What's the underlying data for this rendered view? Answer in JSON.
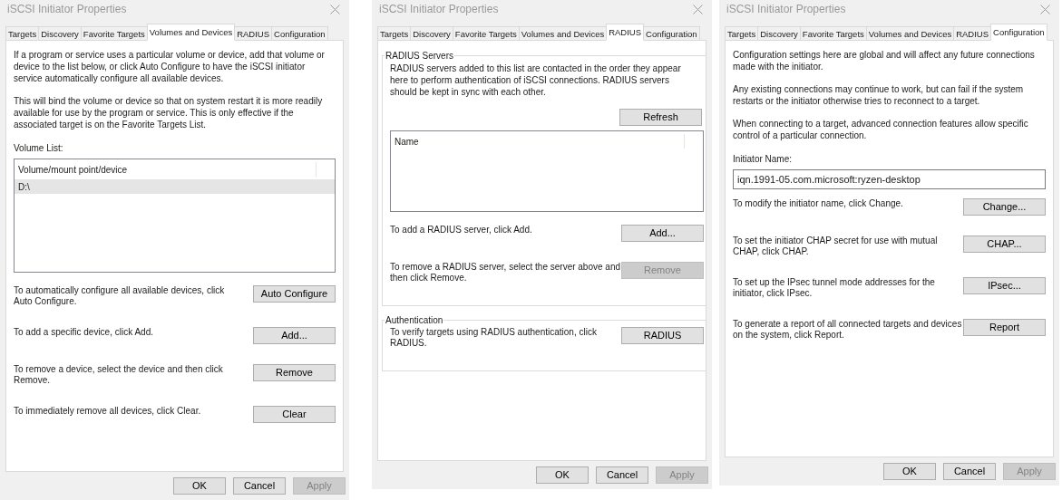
{
  "windows": [
    {
      "title": "iSCSI Initiator Properties",
      "tabs": [
        {
          "label": "Targets",
          "selected": false
        },
        {
          "label": "Discovery",
          "selected": false
        },
        {
          "label": "Favorite Targets",
          "selected": false
        },
        {
          "label": "Volumes and Devices",
          "selected": true
        },
        {
          "label": "RADIUS",
          "selected": false
        },
        {
          "label": "Configuration",
          "selected": false
        }
      ],
      "content": [
        {
          "kind": "paragraph",
          "text": "If a program or service uses a particular volume or device, add that volume or device to the list below, or click Auto Configure to have the iSCSI initiator service automatically configure all available devices."
        },
        {
          "kind": "paragraph",
          "text": "This will bind the volume or device so that on system restart it is more readily available for use by the program or service.  This is only effective if the associated target is on the Favorite Targets List."
        },
        {
          "kind": "label",
          "text": "Volume List:"
        },
        {
          "kind": "list",
          "header": "Volume/mount point/device",
          "rows": [
            {
              "text": "D:\\",
              "selected": true
            }
          ]
        },
        {
          "kind": "action",
          "text": "To automatically configure all available devices, click Auto Configure.",
          "button": "Auto Configure",
          "disabled": false
        },
        {
          "kind": "action",
          "text": "To add a specific device, click Add.",
          "button": "Add...",
          "disabled": false
        },
        {
          "kind": "action",
          "text": "To remove a device, select the device and then click Remove.",
          "button": "Remove",
          "disabled": false
        },
        {
          "kind": "action",
          "text": "To immediately remove all devices, click Clear.",
          "button": "Clear",
          "disabled": false
        }
      ],
      "buttons": [
        {
          "label": "OK",
          "disabled": false
        },
        {
          "label": "Cancel",
          "disabled": false
        },
        {
          "label": "Apply",
          "disabled": true
        }
      ]
    },
    {
      "title": "iSCSI Initiator Properties",
      "tabs": [
        {
          "label": "Targets",
          "selected": false
        },
        {
          "label": "Discovery",
          "selected": false
        },
        {
          "label": "Favorite Targets",
          "selected": false
        },
        {
          "label": "Volumes and Devices",
          "selected": false
        },
        {
          "label": "RADIUS",
          "selected": true
        },
        {
          "label": "Configuration",
          "selected": false
        }
      ],
      "content": [
        {
          "kind": "group",
          "title": "RADIUS Servers",
          "children": [
            {
              "kind": "paragraph",
              "text": "RADIUS servers added to this list are contacted in the order they appear here to perform authentication of iSCSI connections. RADIUS servers should be kept in sync with each other."
            },
            {
              "kind": "button",
              "button": "Refresh",
              "disabled": false
            },
            {
              "kind": "list",
              "header": "Name"
            },
            {
              "kind": "action",
              "text": "To add a RADIUS server, click Add.",
              "button": "Add...",
              "disabled": false
            },
            {
              "kind": "action",
              "text": "To remove a RADIUS server, select the server above and then click Remove.",
              "button": "Remove",
              "disabled": true
            }
          ]
        },
        {
          "kind": "group",
          "title": "Authentication",
          "children": [
            {
              "kind": "action",
              "text": "To verify targets using RADIUS authentication, click RADIUS.",
              "button": "RADIUS",
              "disabled": false
            }
          ]
        }
      ],
      "buttons": [
        {
          "label": "OK",
          "disabled": false
        },
        {
          "label": "Cancel",
          "disabled": false
        },
        {
          "label": "Apply",
          "disabled": true
        }
      ]
    },
    {
      "title": "iSCSI Initiator Properties",
      "tabs": [
        {
          "label": "Targets",
          "selected": false
        },
        {
          "label": "Discovery",
          "selected": false
        },
        {
          "label": "Favorite Targets",
          "selected": false
        },
        {
          "label": "Volumes and Devices",
          "selected": false
        },
        {
          "label": "RADIUS",
          "selected": false
        },
        {
          "label": "Configuration",
          "selected": true
        }
      ],
      "content": [
        {
          "kind": "paragraph",
          "text": "Configuration settings here are global and will affect any future connections made with the initiator."
        },
        {
          "kind": "paragraph",
          "text": "Any existing connections may continue to work, but can fail if the system restarts or the initiator otherwise tries to reconnect to a target."
        },
        {
          "kind": "paragraph",
          "text": "When connecting to a target, advanced connection features allow specific control of a particular connection."
        },
        {
          "kind": "label",
          "text": "Initiator Name:"
        },
        {
          "kind": "field",
          "value": "iqn.1991-05.com.microsoft:ryzen-desktop"
        },
        {
          "kind": "action",
          "text": "To modify the initiator name, click Change.",
          "button": "Change...",
          "disabled": false
        },
        {
          "kind": "action",
          "text": "To set the initiator CHAP secret for use with mutual CHAP, click CHAP.",
          "button": "CHAP...",
          "disabled": false
        },
        {
          "kind": "action",
          "text": "To set up the IPsec tunnel mode addresses for the initiator, click IPsec.",
          "button": "IPsec...",
          "disabled": false
        },
        {
          "kind": "action",
          "text": "To generate a report of all connected targets and devices on the system, click Report.",
          "button": "Report",
          "disabled": false
        }
      ],
      "buttons": [
        {
          "label": "OK",
          "disabled": false
        },
        {
          "label": "Cancel",
          "disabled": false
        },
        {
          "label": "Apply",
          "disabled": true
        }
      ]
    }
  ]
}
